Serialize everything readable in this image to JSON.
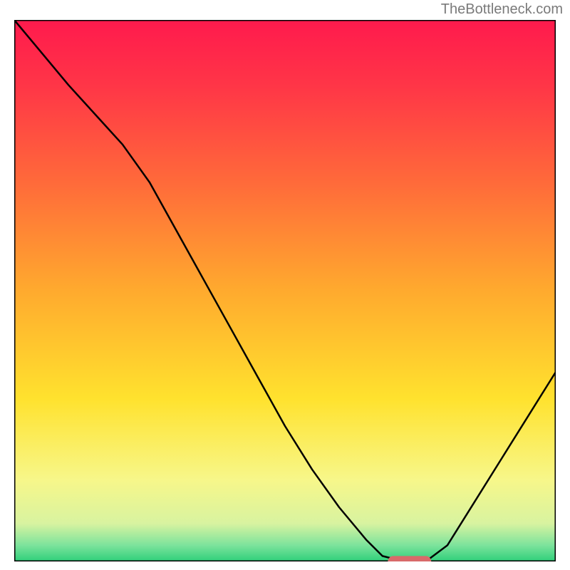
{
  "attribution": "TheBottleneck.com",
  "chart_data": {
    "type": "line",
    "title": "",
    "xlabel": "",
    "ylabel": "",
    "xlim": [
      0,
      100
    ],
    "ylim": [
      0,
      100
    ],
    "background_gradient": {
      "type": "vertical",
      "stops": [
        {
          "pos": 0.0,
          "color": "#ff1a4d"
        },
        {
          "pos": 0.12,
          "color": "#ff3547"
        },
        {
          "pos": 0.3,
          "color": "#ff6a3a"
        },
        {
          "pos": 0.5,
          "color": "#ffaa2e"
        },
        {
          "pos": 0.7,
          "color": "#ffe22e"
        },
        {
          "pos": 0.85,
          "color": "#f7f78a"
        },
        {
          "pos": 0.93,
          "color": "#d8f3a0"
        },
        {
          "pos": 0.97,
          "color": "#7de39c"
        },
        {
          "pos": 1.0,
          "color": "#2ecf7a"
        }
      ]
    },
    "series": [
      {
        "name": "bottleneck-curve",
        "type": "line",
        "color": "#000000",
        "x": [
          0,
          5,
          10,
          15,
          20,
          25,
          30,
          35,
          40,
          45,
          50,
          55,
          60,
          65,
          68,
          72,
          76,
          80,
          85,
          90,
          95,
          100
        ],
        "values": [
          100,
          94,
          88,
          82.5,
          77,
          70,
          61,
          52,
          43,
          34,
          25,
          17,
          10,
          4,
          1,
          0,
          0,
          3,
          11,
          19,
          27,
          35
        ]
      }
    ],
    "marker": {
      "name": "optimal-zone",
      "shape": "rounded-rect",
      "color": "#d86a6a",
      "x_range": [
        69,
        77
      ],
      "y": 0,
      "height_pct": 1.2
    }
  }
}
